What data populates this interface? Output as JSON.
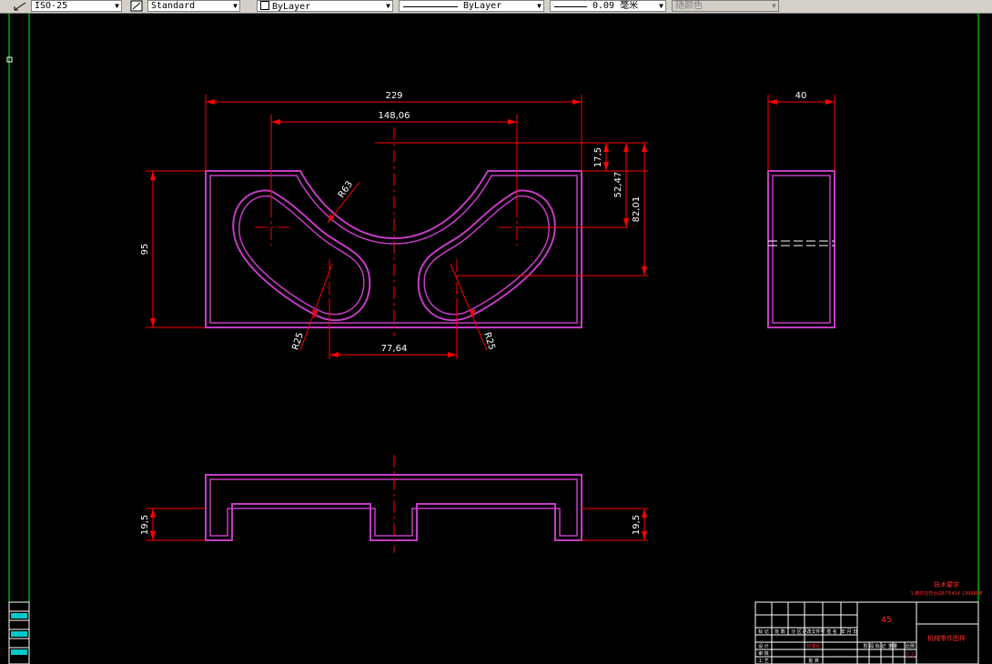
{
  "toolbar": {
    "dim_style": "ISO-25",
    "text_style": "Standard",
    "layer_color": "ByLayer",
    "linetype": "ByLayer",
    "lineweight": "0.09 毫米",
    "plot_style": "随颜色"
  },
  "dimensions": {
    "width_229": "229",
    "span_148": "148,06",
    "r63": "R63",
    "h17": "17,5",
    "h52": "52,47",
    "h82": "82,01",
    "h95": "95",
    "r25_left": "R25",
    "r25_right": "R25",
    "span_77": "77,64",
    "side_width": "40",
    "front_left": "19,5",
    "front_right": "19,5"
  },
  "title_block": {
    "tech_req_title": "技术要求",
    "tech_req_line1": "1.铸件应符合GB/T6414-1999标准",
    "material": "45",
    "part_name": "机械零件图样",
    "header_cells": [
      "标 记",
      "处 数",
      "分 区",
      "更改文件号",
      "签 名",
      "年 月 日"
    ],
    "row_labels": [
      "设 计",
      "审 核",
      "工 艺"
    ],
    "stamp": "标准化",
    "approve": "批 准",
    "stage_cells": [
      "阶 段 标 记",
      "重量",
      "比例"
    ],
    "scale": "1:1"
  },
  "colors": {
    "part_outline": "#c33cc3",
    "dimension": "#ff0000",
    "frame": "#00ff00",
    "table_lines": "#ffffff"
  }
}
